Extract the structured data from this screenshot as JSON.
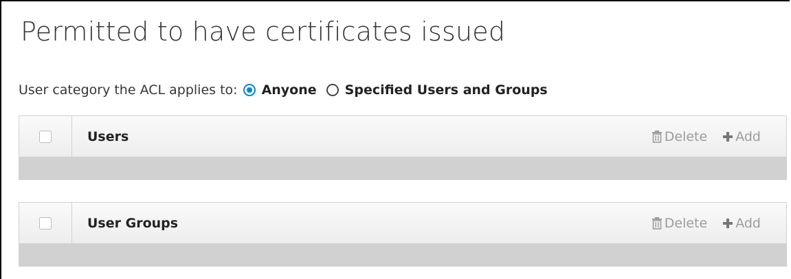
{
  "section": {
    "title": "Permitted to have certificates issued"
  },
  "category": {
    "label": "User category the ACL applies to:",
    "options": [
      {
        "label": "Anyone",
        "selected": true
      },
      {
        "label": "Specified Users and Groups",
        "selected": false
      }
    ]
  },
  "tables": [
    {
      "title": "Users",
      "delete_label": "Delete",
      "add_label": "Add"
    },
    {
      "title": "User Groups",
      "delete_label": "Delete",
      "add_label": "Add"
    }
  ],
  "colors": {
    "accent": "#0088ce",
    "disabled_text": "#9c9c9c",
    "empty_row": "#d1d1d1"
  },
  "icons": {
    "delete": "trash-icon",
    "add": "plus-icon"
  }
}
